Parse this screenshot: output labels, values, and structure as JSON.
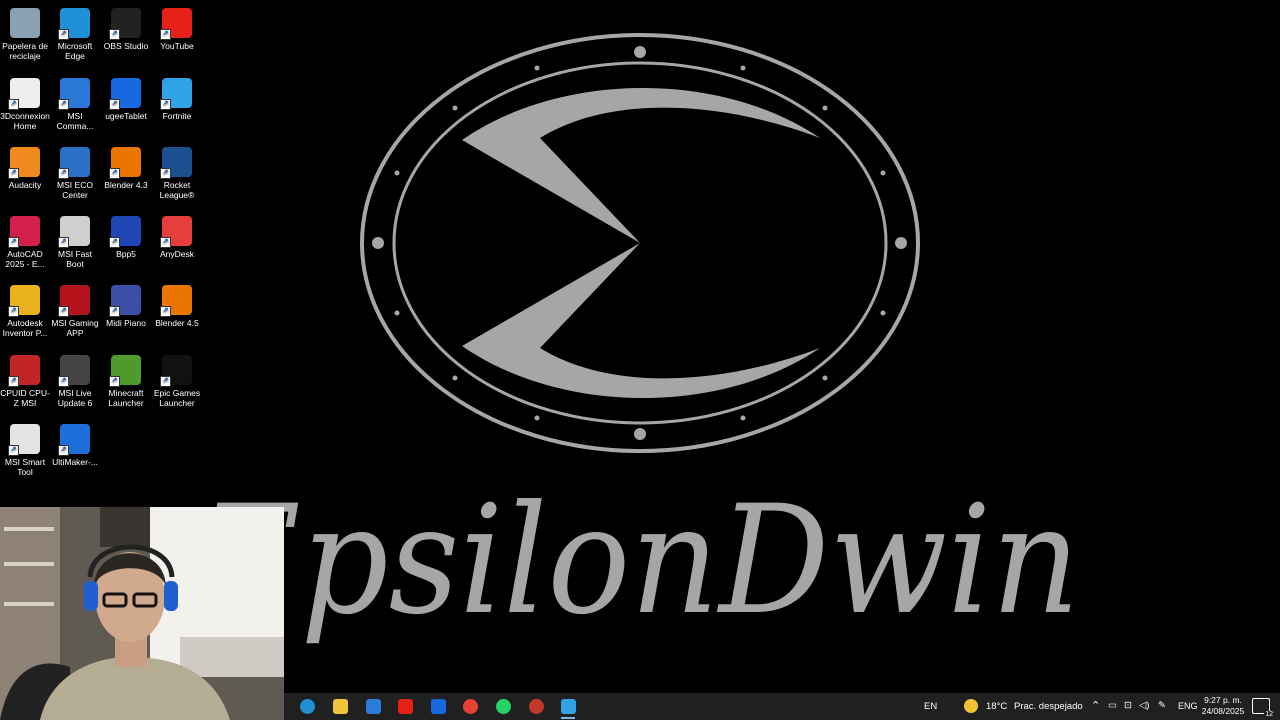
{
  "wallpaper": {
    "text": "EpsilonDwin",
    "color": "#a6a6a6"
  },
  "desktop_icons": [
    {
      "label": "Papelera de reciclaje",
      "icon": "recycle-bin-icon",
      "color": "#8aa0b3"
    },
    {
      "label": "Microsoft Edge",
      "icon": "edge-icon",
      "color": "#1f8fd6"
    },
    {
      "label": "OBS Studio",
      "icon": "obs-icon",
      "color": "#222222"
    },
    {
      "label": "YouTube",
      "icon": "youtube-icon",
      "color": "#e62117"
    },
    {
      "label": "3Dconnexion Home",
      "icon": "3dconnexion-icon",
      "color": "#eeeeee"
    },
    {
      "label": "MSI Comma...",
      "icon": "msi-center-icon",
      "color": "#2b78d8"
    },
    {
      "label": "ugeeTablet",
      "icon": "ugee-icon",
      "color": "#1769e0"
    },
    {
      "label": "Fortnite",
      "icon": "fortnite-icon",
      "color": "#2fa3e6"
    },
    {
      "label": "Audacity",
      "icon": "audacity-icon",
      "color": "#f08a1c"
    },
    {
      "label": "MSI ECO Center",
      "icon": "msi-eco-icon",
      "color": "#2c6fc8"
    },
    {
      "label": "Blender 4.3",
      "icon": "blender-icon",
      "color": "#ea7600"
    },
    {
      "label": "Rocket League®",
      "icon": "rocket-league-icon",
      "color": "#1c4f8f"
    },
    {
      "label": "AutoCAD 2025 - E...",
      "icon": "autocad-icon",
      "color": "#d2204b"
    },
    {
      "label": "MSI Fast Boot",
      "icon": "msi-fastboot-icon",
      "color": "#cfcfcf"
    },
    {
      "label": "Bpp5",
      "icon": "bpp5-icon",
      "color": "#2046b5"
    },
    {
      "label": "AnyDesk",
      "icon": "anydesk-icon",
      "color": "#e83d3d"
    },
    {
      "label": "Autodesk Inventor P...",
      "icon": "inventor-icon",
      "color": "#e9b21c"
    },
    {
      "label": "MSI Gaming APP",
      "icon": "msi-gaming-icon",
      "color": "#b3141c"
    },
    {
      "label": "Midi Piano",
      "icon": "midi-piano-icon",
      "color": "#3a4fa5"
    },
    {
      "label": "Blender 4.5",
      "icon": "blender-icon",
      "color": "#ea7600"
    },
    {
      "label": "CPUID CPU-Z MSI",
      "icon": "cpuz-icon",
      "color": "#c12525"
    },
    {
      "label": "MSI Live Update 6",
      "icon": "msi-live-update-icon",
      "color": "#444444"
    },
    {
      "label": "Minecraft Launcher",
      "icon": "minecraft-icon",
      "color": "#4e9a2f"
    },
    {
      "label": "Epic Games Launcher",
      "icon": "epic-games-icon",
      "color": "#111111"
    },
    {
      "label": "MSI Smart Tool",
      "icon": "msi-smart-tool-icon",
      "color": "#e4e4e4"
    },
    {
      "label": "UltiMaker-...",
      "icon": "ultimaker-icon",
      "color": "#1f6fdb"
    }
  ],
  "taskbar": {
    "apps": [
      {
        "name": "edge",
        "icon": "edge-icon",
        "color": "#1f8fd6"
      },
      {
        "name": "file-explorer",
        "icon": "folder-icon",
        "color": "#f0c43a"
      },
      {
        "name": "store",
        "icon": "store-icon",
        "color": "#2b7bd9"
      },
      {
        "name": "youtube",
        "icon": "youtube-icon",
        "color": "#e62117"
      },
      {
        "name": "ugee",
        "icon": "ugee-icon",
        "color": "#1769e0"
      },
      {
        "name": "chrome",
        "icon": "chrome-icon",
        "color": "#e64234"
      },
      {
        "name": "whatsapp",
        "icon": "whatsapp-icon",
        "color": "#25d366"
      },
      {
        "name": "obs",
        "icon": "obs-icon",
        "color": "#c0392b"
      },
      {
        "name": "fortnite",
        "icon": "fortnite-icon",
        "color": "#2fa3e6"
      }
    ],
    "lang_short": "EN",
    "weather": {
      "temp": "18°C",
      "desc": "Prac. despejado"
    },
    "lang": "ENG",
    "time": "9:27 p. m.",
    "date": "24/08/2025",
    "notifications": "12"
  }
}
